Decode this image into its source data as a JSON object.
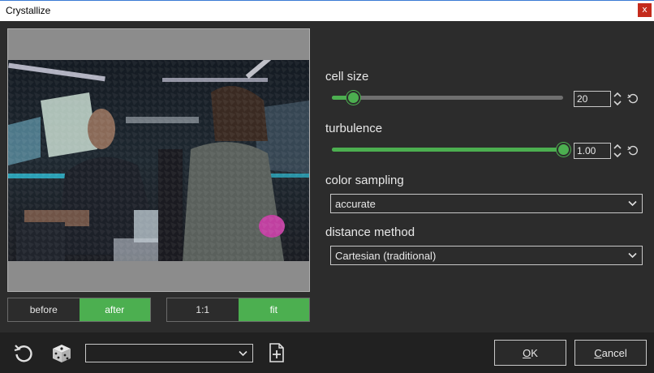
{
  "window": {
    "title": "Crystallize",
    "close_label": "x"
  },
  "preview": {
    "before_label": "before",
    "after_label": "after",
    "active_mode": "after",
    "zoom_1to1_label": "1:1",
    "zoom_fit_label": "fit",
    "active_zoom": "fit"
  },
  "settings": {
    "cell_size": {
      "label": "cell size",
      "value": "20",
      "slider_fraction": 0.09
    },
    "turbulence": {
      "label": "turbulence",
      "value": "1.00",
      "slider_fraction": 1.0
    },
    "color_sampling": {
      "label": "color sampling",
      "selected": "accurate"
    },
    "distance_method": {
      "label": "distance method",
      "selected": "Cartesian (traditional)"
    }
  },
  "bottom": {
    "preset_value": "",
    "ok_label": "OK",
    "cancel_label": "Cancel"
  },
  "colors": {
    "accent": "#4caf50",
    "panel": "#2c2c2c",
    "bottom_bar": "#212121"
  },
  "icons": [
    "reset-icon",
    "dice-icon",
    "new-preset-icon",
    "spin-icon",
    "reset-small-icon",
    "chevron-down-icon"
  ]
}
